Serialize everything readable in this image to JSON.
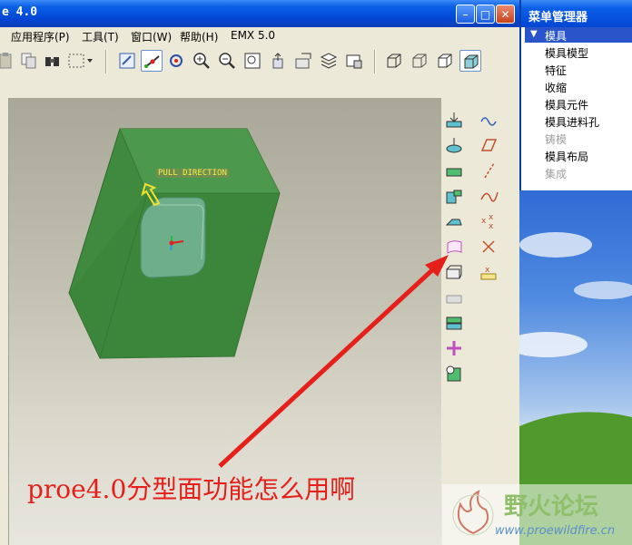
{
  "window": {
    "title": "e 4.0",
    "min_glyph": "–",
    "max_glyph": "□",
    "close_glyph": "✕"
  },
  "menu": [
    "应用程序(P)",
    "工具(T)",
    "窗口(W)",
    "帮助(H)",
    "EMX 5.0"
  ],
  "toolbar_icons": [
    "paste-icon",
    "copy-icon",
    "find-icon",
    "select-box-icon",
    "redraw-icon",
    "spin-center-icon",
    "orient-icon",
    "zoom-in-icon",
    "zoom-out-icon",
    "refit-icon",
    "reorient-icon",
    "saved-views-icon",
    "layers-icon",
    "model-display-icon",
    "wireframe-icon",
    "hidden-line-icon",
    "no-hidden-icon",
    "shading-icon"
  ],
  "viewport": {
    "label": "PULL DIRECTION"
  },
  "menu_manager": {
    "title": "菜单管理器",
    "header": "模具",
    "items": [
      {
        "label": "模具模型",
        "enabled": true
      },
      {
        "label": "特征",
        "enabled": true
      },
      {
        "label": "收缩",
        "enabled": true
      },
      {
        "label": "模具元件",
        "enabled": true
      },
      {
        "label": "模具进料孔",
        "enabled": true
      },
      {
        "label": "铸模",
        "enabled": false
      },
      {
        "label": "模具布局",
        "enabled": true
      },
      {
        "label": "集成",
        "enabled": false
      }
    ]
  },
  "annotation": {
    "question": "proe4.0分型面功能怎么用啊",
    "arrow_color": "#e5201b"
  },
  "watermark": {
    "title": "野火论坛",
    "url": "www.proewildfire.cn"
  },
  "colors": {
    "mold_green": "#3f8a3f",
    "title_blue": "#0a5fe6"
  }
}
